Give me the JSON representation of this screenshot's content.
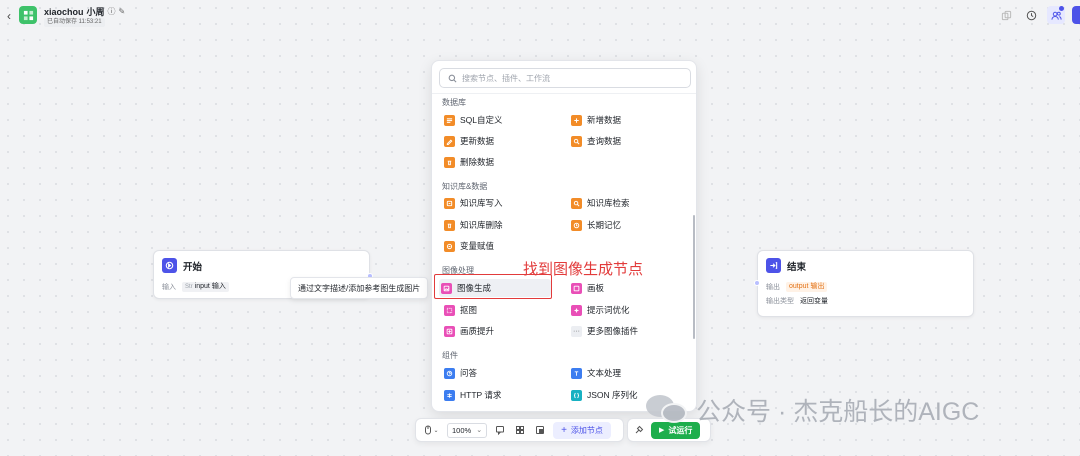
{
  "header": {
    "back_icon": "chevron-left-icon",
    "app_name": "xiaochou",
    "app_owner": "小周",
    "saved_text": "已自动保存 11:53:21",
    "brand_color": "#3ec26a",
    "accent_color": "#4d53e8"
  },
  "start_node": {
    "title": "开始",
    "row_label": "输入",
    "var_type": "Str",
    "var_name": "input",
    "var_desc": "输入"
  },
  "tooltip": {
    "text": "通过文字描述/添加参考图生成图片"
  },
  "end_node": {
    "title": "结束",
    "output_label": "输出",
    "output_var": "output",
    "output_desc": "输出",
    "type_label": "输出类型",
    "type_value": "返回变量"
  },
  "picker": {
    "search_placeholder": "搜索节点、插件、工作流",
    "sections": [
      {
        "title": "数据库",
        "items": [
          {
            "label": "SQL自定义",
            "icon": "sql-icon",
            "color": "orange"
          },
          {
            "label": "新增数据",
            "icon": "database-add-icon",
            "color": "orange"
          },
          {
            "label": "更新数据",
            "icon": "database-update-icon",
            "color": "orange"
          },
          {
            "label": "查询数据",
            "icon": "database-query-icon",
            "color": "orange"
          },
          {
            "label": "删除数据",
            "icon": "database-delete-icon",
            "color": "orange"
          }
        ]
      },
      {
        "title": "知识库&数据",
        "items": [
          {
            "label": "知识库写入",
            "icon": "knowledge-write-icon",
            "color": "orange"
          },
          {
            "label": "知识库检索",
            "icon": "knowledge-search-icon",
            "color": "orange"
          },
          {
            "label": "知识库删除",
            "icon": "knowledge-delete-icon",
            "color": "orange"
          },
          {
            "label": "长期记忆",
            "icon": "memory-icon",
            "color": "orange"
          },
          {
            "label": "变量赋值",
            "icon": "variable-icon",
            "color": "orange"
          }
        ]
      },
      {
        "title": "图像处理",
        "items": [
          {
            "label": "图像生成",
            "icon": "image-generate-icon",
            "color": "magenta"
          },
          {
            "label": "画板",
            "icon": "canvas-icon",
            "color": "magenta"
          },
          {
            "label": "抠图",
            "icon": "cutout-icon",
            "color": "magenta"
          },
          {
            "label": "提示词优化",
            "icon": "prompt-optimize-icon",
            "color": "magenta"
          },
          {
            "label": "画质提升",
            "icon": "image-enhance-icon",
            "color": "magenta"
          },
          {
            "label": "更多图像插件",
            "icon": "more-icon",
            "color": "grey"
          }
        ]
      },
      {
        "title": "组件",
        "items": [
          {
            "label": "问答",
            "icon": "qa-icon",
            "color": "blue"
          },
          {
            "label": "文本处理",
            "icon": "text-process-icon",
            "color": "blue"
          },
          {
            "label": "HTTP 请求",
            "icon": "http-icon",
            "color": "blue"
          },
          {
            "label": "JSON 序列化",
            "icon": "json-icon",
            "color": "cyan"
          }
        ]
      }
    ]
  },
  "annotation": {
    "text": "找到图像生成节点",
    "color": "#e23b3b"
  },
  "toolbar": {
    "zoom": "100%",
    "add_node_label": "添加节点",
    "run_label": "试运行"
  },
  "watermark": {
    "text": "公众号 · 杰克船长的AIGC"
  }
}
